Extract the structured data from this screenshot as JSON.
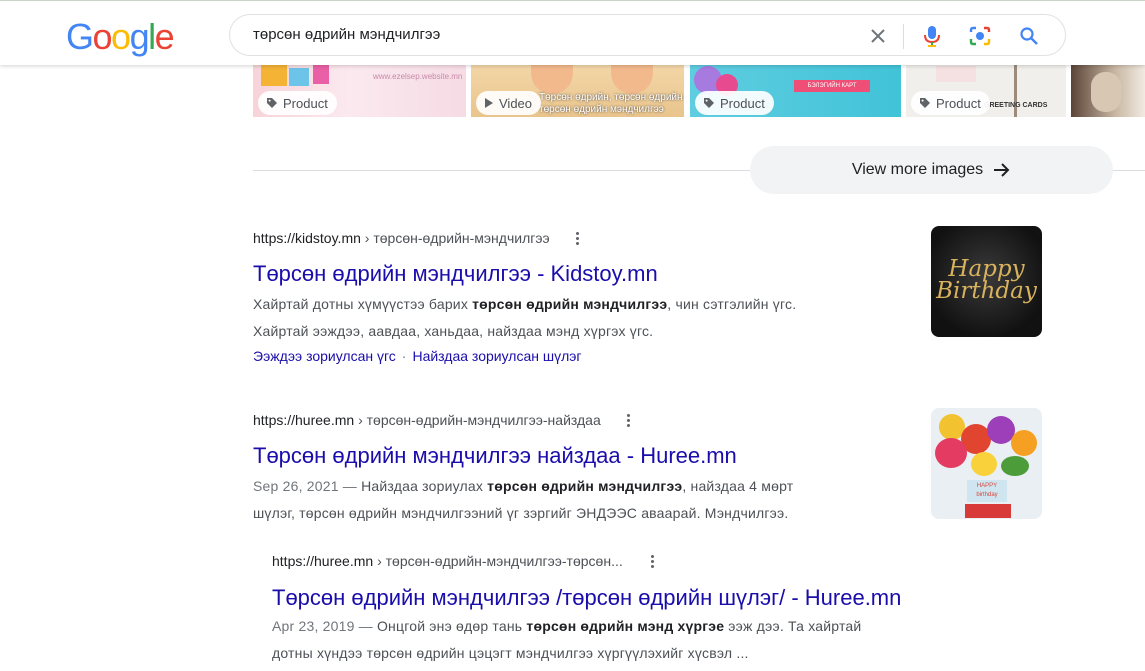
{
  "header": {
    "logo_letters": [
      "G",
      "o",
      "o",
      "g",
      "l",
      "e"
    ],
    "logo_colors": [
      "#4285F4",
      "#EA4335",
      "#FBBC05",
      "#4285F4",
      "#34A853",
      "#EA4335"
    ],
    "search_query": "төрсөн өдрийн мэндчилгээ",
    "icons": [
      "close-icon",
      "microphone-icon",
      "camera-lens-icon",
      "search-icon"
    ]
  },
  "image_strip": {
    "tiles": [
      {
        "badge": "Product",
        "icon": "tag-icon",
        "thumb_text": "www.ezelsep.website.mn"
      },
      {
        "badge": "Video",
        "icon": "play-icon",
        "thumb_text": "Төрсөн өдрийн, төрсөн өдрийн төрсөн өдрийн мэндчилгээ"
      },
      {
        "badge": "Product",
        "icon": "tag-icon",
        "thumb_text": "БЭЛЭГИЙН КАРТ"
      },
      {
        "badge": "Product",
        "icon": "tag-icon",
        "thumb_text": "GREETING CARDS"
      },
      {
        "badge": "",
        "icon": "",
        "thumb_text": ""
      }
    ],
    "view_more_label": "View more images"
  },
  "results": [
    {
      "domain": "https://kidstoy.mn",
      "crumb": "› төрсөн-өдрийн-мэндчилгээ",
      "title": "Төрсөн өдрийн мэндчилгээ - Kidstoy.mn",
      "snippet_line1_pre": "Хайртай дотны хүмүүстээ барих ",
      "snippet_line1_bold": "төрсөн өдрийн мэндчилгээ",
      "snippet_line1_post": ", чин сэтгэлийн үгс.",
      "snippet_line2": "Хайртай ээждээ, аавдаа, ханьдаа, найздаа мэнд хүргэх үгс.",
      "sitelinks": [
        "Ээждээ зориулсан үгс",
        "Найздаа зориулсан шүлэг"
      ],
      "sitelink_sep": "·",
      "thumb_text": "Happy Birthday"
    },
    {
      "domain": "https://huree.mn",
      "crumb": "› төрсөн-өдрийн-мэндчилгээ-найздаа",
      "title": "Төрсөн өдрийн мэндчилгээ найздаа - Huree.mn",
      "date": "Sep 26, 2021",
      "dash": " — ",
      "snippet_line1_pre": "Найздаа зориулах ",
      "snippet_line1_bold": "төрсөн өдрийн мэндчилгээ",
      "snippet_line1_post": ", найздаа 4 мөрт",
      "snippet_line2": "шүлэг, төрсөн өдрийн мэндчилгээний үг зэргийг ЭНДЭЭС аваарай. Мэндчилгээ.",
      "thumb_text": "HAPPY birthday"
    },
    {
      "domain": "https://huree.mn",
      "crumb": "› төрсөн-өдрийн-мэндчилгээ-төрсөн...",
      "title": "Төрсөн өдрийн мэндчилгээ /төрсөн өдрийн шүлэг/ - Huree.mn",
      "date": "Apr 23, 2019",
      "dash": " — ",
      "snippet_line1_pre": "Онцгой энэ өдөр тань ",
      "snippet_line1_bold": "төрсөн өдрийн мэнд хүргэе",
      "snippet_line1_post": " ээж дээ. Та хайртай",
      "snippet_line2": "дотны хүндээ төрсөн өдрийн цэцэгт мэндчилгээ хүргүүлэхийг хүсвэл ..."
    }
  ]
}
